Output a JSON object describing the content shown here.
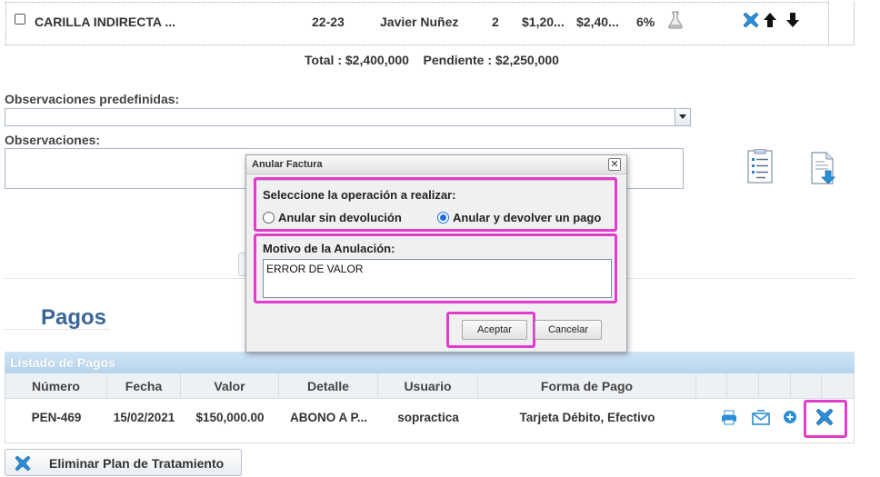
{
  "treatment_row": {
    "name": "CARILLA INDIRECTA ...",
    "teeth": "22-23",
    "doctor": "Javier Nuñez",
    "qty": "2",
    "unit_price": "$1,20...",
    "total": "$2,40...",
    "discount": "6%"
  },
  "totals": {
    "total": "Total : $2,400,000",
    "pending": "Pendiente : $2,250,000"
  },
  "observations": {
    "predefined_label": "Observaciones predefinidas:",
    "label": "Observaciones:"
  },
  "pagos": {
    "title": "Pagos",
    "list_title": "Listado de Pagos",
    "columns": [
      "Número",
      "Fecha",
      "Valor",
      "Detalle",
      "Usuario",
      "Forma de Pago"
    ],
    "rows": [
      {
        "number": "PEN-469",
        "date": "15/02/2021",
        "value": "$150,000.00",
        "detail": "ABONO A P...",
        "user": "sopractica",
        "payment_method": "Tarjeta Débito, Efectivo"
      }
    ]
  },
  "delete_plan_button": "Eliminar Plan de Tratamiento",
  "modal": {
    "title": "Anular Factura",
    "close": "✕",
    "operation_prompt": "Seleccione la operación a realizar:",
    "option_no_refund": "Anular sin devolución",
    "option_refund": "Anular y devolver un pago",
    "selected_option": "Anular y devolver un pago",
    "reason_label": "Motivo de la Anulación:",
    "reason_value": "ERROR DE VALOR",
    "accept": "Aceptar",
    "cancel": "Cancelar"
  },
  "colors": {
    "highlight": "#e23ccf",
    "title_blue": "#3a6797",
    "table_header": "#b7d4ee",
    "radio_blue": "#1b6fd8",
    "icon_blue": "#2a8fd6"
  },
  "icons": {
    "row_actions": [
      "delete-x-icon",
      "arrow-up-icon",
      "arrow-down-icon"
    ],
    "flask": "flask-icon",
    "documents": [
      "document-list-icon",
      "document-download-icon"
    ],
    "payment_actions": [
      "print-icon",
      "email-icon",
      "plus-circle-icon",
      "delete-x-icon"
    ]
  }
}
